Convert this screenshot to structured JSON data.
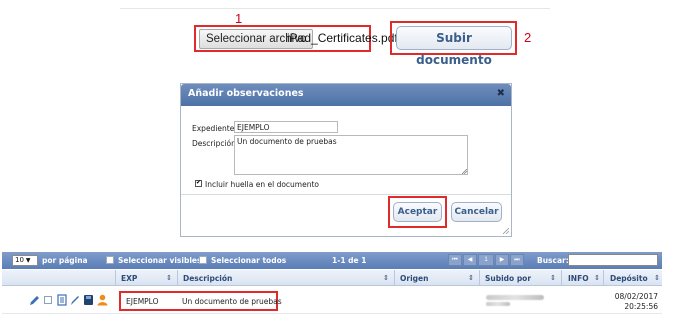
{
  "annotations": {
    "num1": "1",
    "num2": "2"
  },
  "upload": {
    "select_file_label": "Seleccionar archivo",
    "file_name": "iPad_Certificates.pdf",
    "submit_label": "Subir documento"
  },
  "dialog": {
    "title": "Añadir observaciones",
    "close_glyph": "✖",
    "expediente_label": "Expediente:",
    "expediente_value": "EJEMPLO",
    "descripcion_label": "Descripción:",
    "descripcion_value": "Un documento de pruebas",
    "include_hash_label": "Incluir huella en el documento",
    "include_hash_checked": true,
    "accept_label": "Aceptar",
    "cancel_label": "Cancelar"
  },
  "table": {
    "per_page_value": "10",
    "per_page_label": "por página",
    "select_visible_label": "Seleccionar visibles",
    "select_all_label": "Seleccionar todos",
    "range": "1-1 de 1",
    "page_number": "1",
    "search_label": "Buscar:",
    "search_value": "",
    "headers": [
      "EXP",
      "Descripción",
      "Origen",
      "Subido por",
      "INFO",
      "Depósito"
    ],
    "rows": [
      {
        "exp": "EJEMPLO",
        "descripcion": "Un documento de pruebas",
        "deposito_date": "08/02/2017",
        "deposito_time": "20:25:56"
      }
    ]
  },
  "colors": {
    "annotation_red": "#e02b2b",
    "header_blue": "#5a7db6",
    "accent_text": "#3a5f8c",
    "user_icon_orange": "#f08c1a",
    "icon_blue": "#3b6fb6"
  }
}
